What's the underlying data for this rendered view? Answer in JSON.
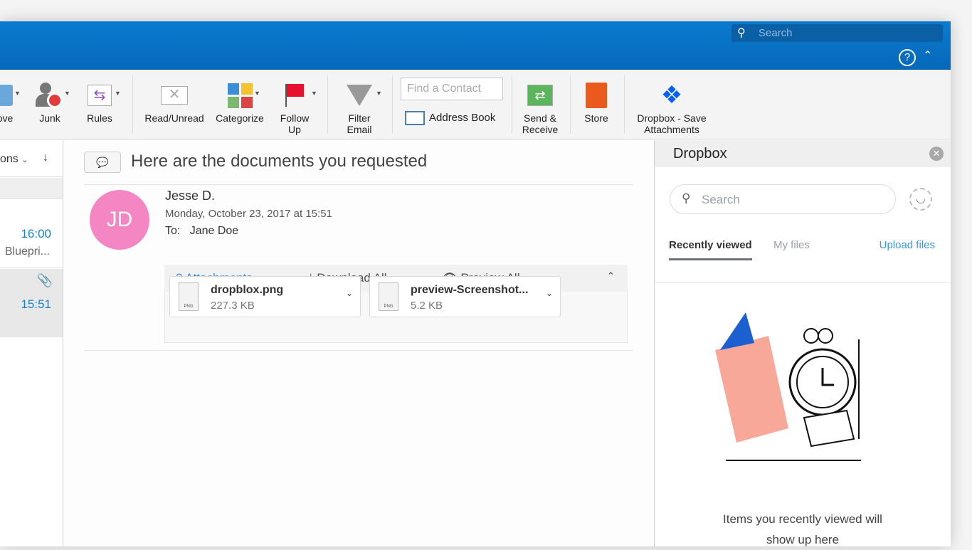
{
  "topbar": {
    "search_placeholder": "Search",
    "help": "?",
    "collapse": "^"
  },
  "ribbon": {
    "move": "ove",
    "junk": "Junk",
    "rules": "Rules",
    "read_unread": "Read/Unread",
    "categorize": "Categorize",
    "follow_up": "Follow Up",
    "filter_email": "Filter Email",
    "find_contact_placeholder": "Find a Contact",
    "address_book": "Address Book",
    "send_receive": "Send & Receive",
    "store": "Store",
    "dropbox_save": "Dropbox - Save Attachments"
  },
  "list": {
    "sort_label": "ons",
    "items": [
      {
        "time": "16:00",
        "preview": "Bluepri..."
      },
      {
        "time": "15:51"
      }
    ]
  },
  "message": {
    "subject": "Here are the documents you requested",
    "initials": "JD",
    "sender": "Jesse D.",
    "date": "Monday, October 23, 2017 at 15:51",
    "to_label": "To:",
    "to": "Jane Doe",
    "attachments_count": "2 Attachments",
    "download_all": "Download All",
    "preview_all": "Preview All",
    "attachments": [
      {
        "name": "dropblox.png",
        "size": "227.3 KB",
        "type": "PNG"
      },
      {
        "name": "preview-Screenshot...",
        "size": "5.2 KB",
        "type": "PNG"
      }
    ]
  },
  "dropbox": {
    "title": "Dropbox",
    "search_placeholder": "Search",
    "tabs": [
      "Recently viewed",
      "My files"
    ],
    "upload": "Upload files",
    "empty_line1": "Items you recently viewed will",
    "empty_line2": "show up here"
  },
  "colors": {
    "accent": "#0a7bd0",
    "avatar": "#f486c4",
    "link": "#3d95e5"
  }
}
